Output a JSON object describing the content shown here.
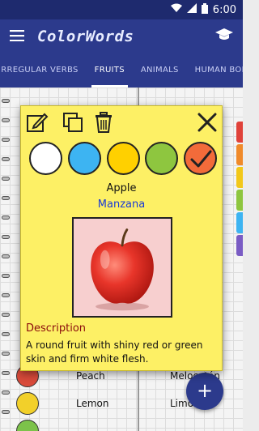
{
  "status_bar": {
    "time": "6:00"
  },
  "app_bar": {
    "title": "ColorWords"
  },
  "tabs": [
    {
      "label": "IRREGULAR VERBS"
    },
    {
      "label": "FRUITS"
    },
    {
      "label": "ANIMALS"
    },
    {
      "label": "HUMAN BODY"
    }
  ],
  "list": [
    {
      "english": "Peach",
      "spanish": "Melocotón",
      "color": "#d84a3a"
    },
    {
      "english": "Lemon",
      "spanish": "Limón",
      "color": "#f2d02a"
    },
    {
      "english": "",
      "spanish": "",
      "color": "#7cc24a"
    }
  ],
  "card": {
    "english_word": "Apple",
    "translation": "Manzana",
    "description_title": "Description",
    "description": "A round fruit with shiny red or green skin and firm white flesh.",
    "swatches": [
      {
        "name": "white",
        "color": "#ffffff",
        "selected": false
      },
      {
        "name": "blue",
        "color": "#3db4f2",
        "selected": false
      },
      {
        "name": "yellow",
        "color": "#ffd000",
        "selected": false
      },
      {
        "name": "green",
        "color": "#8ec63f",
        "selected": false
      },
      {
        "name": "orange",
        "color": "#f26b3a",
        "selected": true
      }
    ]
  },
  "fab": {
    "label": "+"
  },
  "colors": {
    "primary": "#2c3a8c",
    "status": "#1e2a6e",
    "card": "#fdf065",
    "translation": "#1a3ad6",
    "description_title": "#8b0c0c"
  }
}
